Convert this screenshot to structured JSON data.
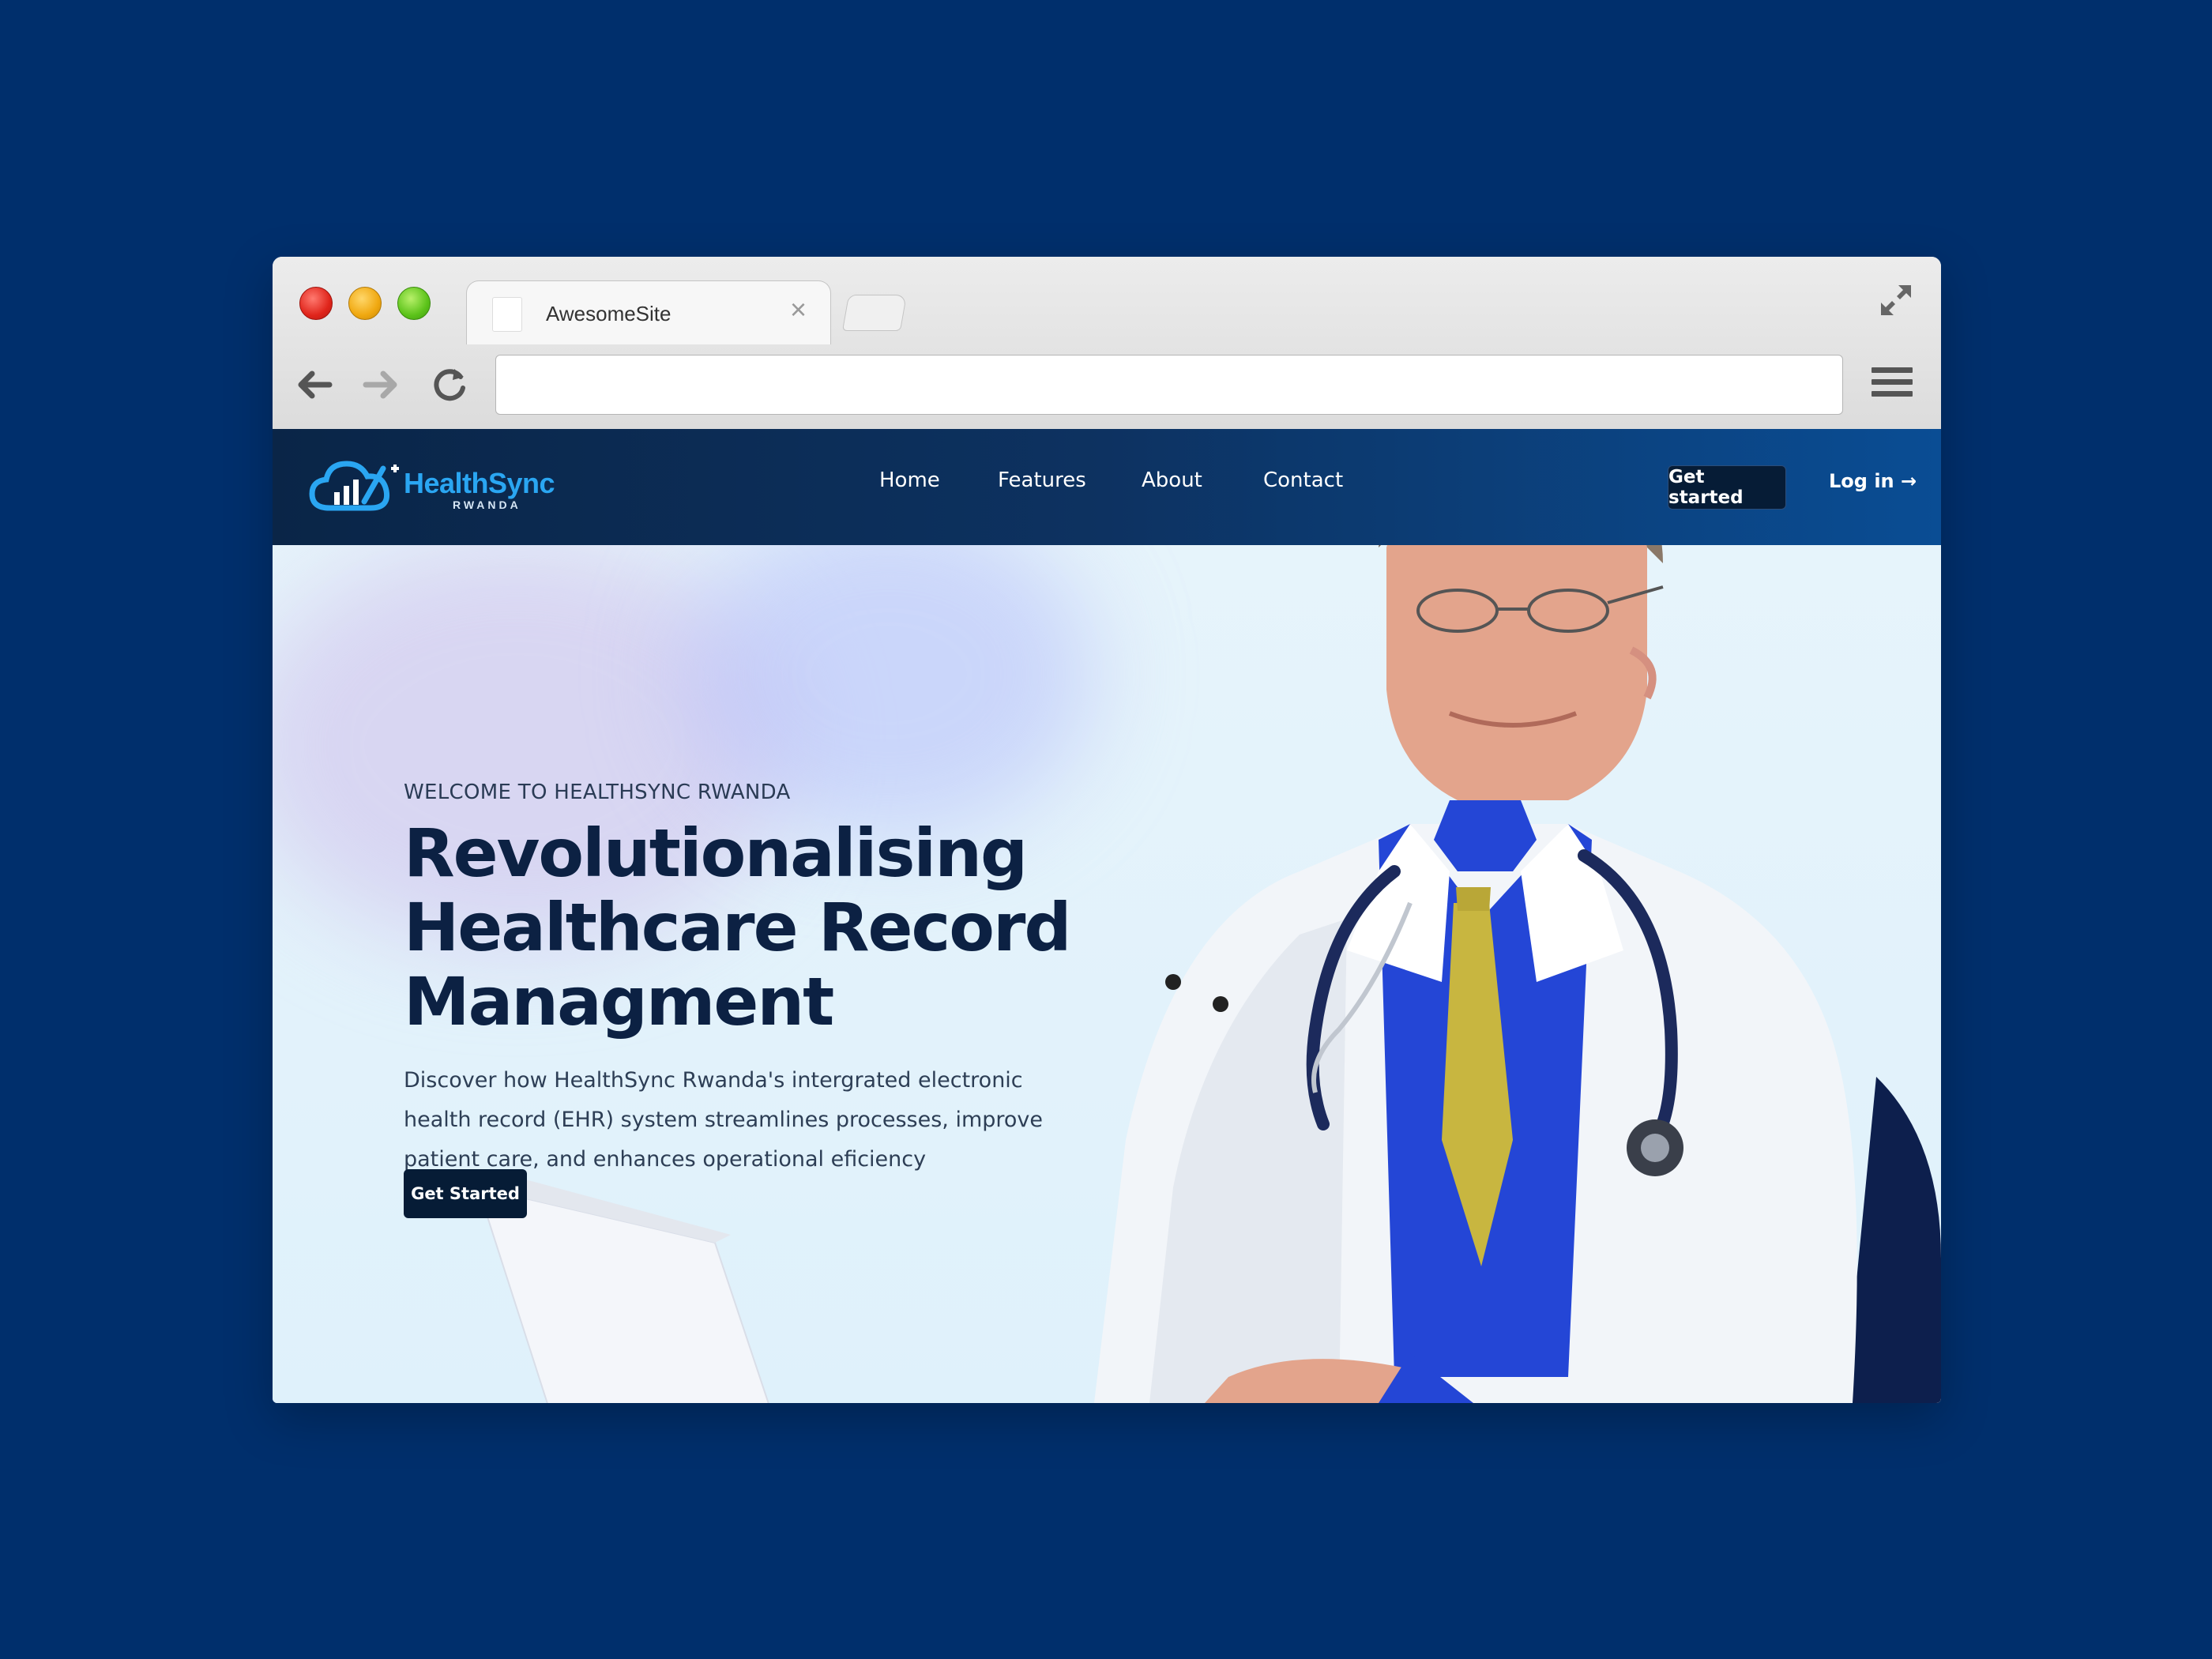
{
  "browser": {
    "tab_title": "AwesomeSite",
    "tab_close": "×",
    "address_value": ""
  },
  "site": {
    "logo": {
      "name": "HealthSync",
      "sub": "RWANDA"
    },
    "nav": [
      "Home",
      "Features",
      "About",
      "Contact"
    ],
    "cta_top": "Get started",
    "login": "Log in →"
  },
  "hero": {
    "eyebrow": "WELCOME TO HEALTHSYNC RWANDA",
    "headline_lines": [
      "Revolutionalising",
      "Healthcare Record",
      "Managment"
    ],
    "description": "Discover how HealthSync Rwanda's intergrated electronic health record (EHR) system streamlines processes, improve patient care, and enhances operational eficiency",
    "cta": "Get Started"
  },
  "colors": {
    "page_background": "#002f6c",
    "header_dark": "#0a2547",
    "header_light": "#0a4d94",
    "button_dark": "#061c36",
    "headline": "#0c2143",
    "logo_blue": "#2aa6f2",
    "hero_bg": "#e3f3fb"
  }
}
